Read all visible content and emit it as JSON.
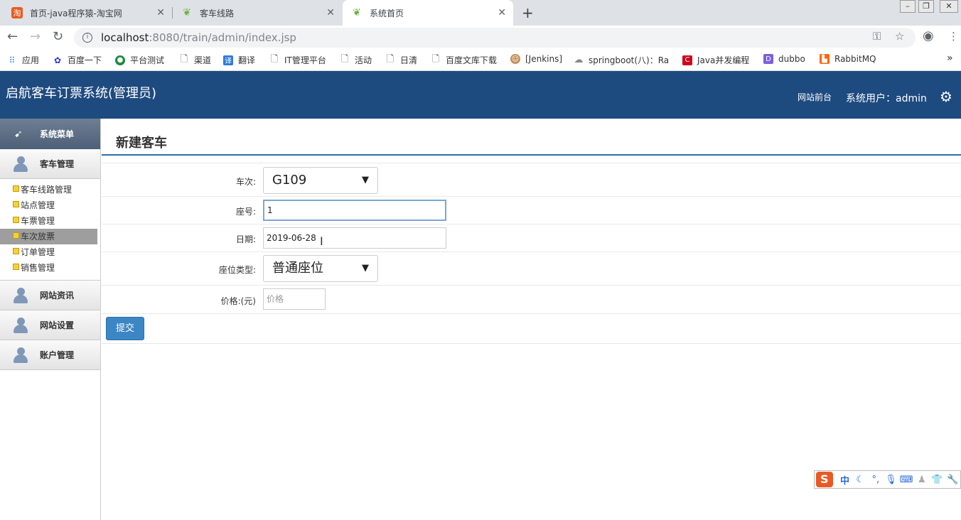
{
  "browser": {
    "tabs": [
      {
        "title": "首页-java程序猿-淘宝网",
        "icon": "taobao-icon",
        "active": false
      },
      {
        "title": "客车线路",
        "icon": "leaf-icon",
        "active": false
      },
      {
        "title": "系统首页",
        "icon": "leaf-icon",
        "active": true
      }
    ],
    "url_host": "localhost",
    "url_path": ":8080/train/admin/index.jsp",
    "bookmarks": [
      {
        "label": "应用",
        "icon": "apps-grid-icon"
      },
      {
        "label": "百度一下",
        "icon": "baidu-paw-icon"
      },
      {
        "label": "平台测试",
        "icon": "platform-icon"
      },
      {
        "label": "渠道",
        "icon": "page-icon"
      },
      {
        "label": "翻译",
        "icon": "translate-icon"
      },
      {
        "label": "IT管理平台",
        "icon": "page-icon"
      },
      {
        "label": "活动",
        "icon": "page-icon"
      },
      {
        "label": "日清",
        "icon": "page-icon"
      },
      {
        "label": "百度文库下载",
        "icon": "page-icon"
      },
      {
        "label": "[Jenkins]",
        "icon": "jenkins-icon"
      },
      {
        "label": "springboot(八)：Ra",
        "icon": "cloud-icon"
      },
      {
        "label": "Java并发编程",
        "icon": "c-logo-icon"
      },
      {
        "label": "dubbo",
        "icon": "dubbo-icon"
      },
      {
        "label": "RabbitMQ",
        "icon": "rabbitmq-icon"
      }
    ]
  },
  "header": {
    "title": "启航客车订票系统(管理员)",
    "front_link": "网站前台",
    "user_label": "系统用户：admin"
  },
  "sidebar": {
    "head": "系统菜单",
    "groups": [
      {
        "label": "客车管理"
      },
      {
        "label": "网站资讯"
      },
      {
        "label": "网站设置"
      },
      {
        "label": "账户管理"
      }
    ],
    "sub_items": [
      "客车线路管理",
      "站点管理",
      "车票管理",
      "车次放票",
      "订单管理",
      "销售管理"
    ],
    "active_sub": "车次放票"
  },
  "form": {
    "title": "新建客车",
    "train_label": "车次:",
    "train_value": "G109",
    "seat_no_label": "座号:",
    "seat_no_value": "1",
    "date_label": "日期:",
    "date_value": "2019-06-28",
    "seat_type_label": "座位类型:",
    "seat_type_value": "普通座位",
    "price_label": "价格:(元)",
    "price_placeholder": "价格",
    "submit_label": "提交"
  },
  "ime": {
    "logo": "S",
    "mode": "中"
  },
  "colors": {
    "header_bg": "#1e4b7f",
    "accent": "#2e6da4",
    "button": "#3b86c4"
  }
}
